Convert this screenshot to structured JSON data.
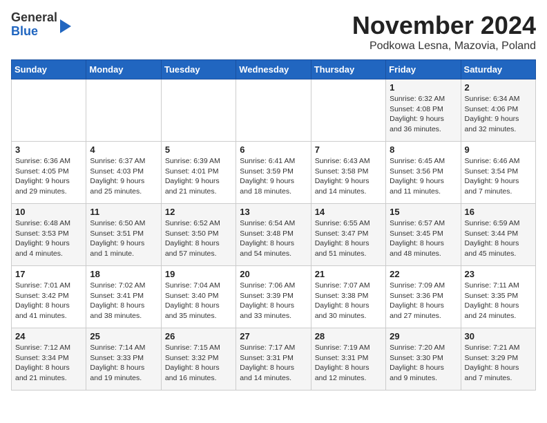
{
  "logo": {
    "general": "General",
    "blue": "Blue"
  },
  "title": "November 2024",
  "subtitle": "Podkowa Lesna, Mazovia, Poland",
  "days_of_week": [
    "Sunday",
    "Monday",
    "Tuesday",
    "Wednesday",
    "Thursday",
    "Friday",
    "Saturday"
  ],
  "weeks": [
    [
      {
        "day": "",
        "info": ""
      },
      {
        "day": "",
        "info": ""
      },
      {
        "day": "",
        "info": ""
      },
      {
        "day": "",
        "info": ""
      },
      {
        "day": "",
        "info": ""
      },
      {
        "day": "1",
        "info": "Sunrise: 6:32 AM\nSunset: 4:08 PM\nDaylight: 9 hours\nand 36 minutes."
      },
      {
        "day": "2",
        "info": "Sunrise: 6:34 AM\nSunset: 4:06 PM\nDaylight: 9 hours\nand 32 minutes."
      }
    ],
    [
      {
        "day": "3",
        "info": "Sunrise: 6:36 AM\nSunset: 4:05 PM\nDaylight: 9 hours\nand 29 minutes."
      },
      {
        "day": "4",
        "info": "Sunrise: 6:37 AM\nSunset: 4:03 PM\nDaylight: 9 hours\nand 25 minutes."
      },
      {
        "day": "5",
        "info": "Sunrise: 6:39 AM\nSunset: 4:01 PM\nDaylight: 9 hours\nand 21 minutes."
      },
      {
        "day": "6",
        "info": "Sunrise: 6:41 AM\nSunset: 3:59 PM\nDaylight: 9 hours\nand 18 minutes."
      },
      {
        "day": "7",
        "info": "Sunrise: 6:43 AM\nSunset: 3:58 PM\nDaylight: 9 hours\nand 14 minutes."
      },
      {
        "day": "8",
        "info": "Sunrise: 6:45 AM\nSunset: 3:56 PM\nDaylight: 9 hours\nand 11 minutes."
      },
      {
        "day": "9",
        "info": "Sunrise: 6:46 AM\nSunset: 3:54 PM\nDaylight: 9 hours\nand 7 minutes."
      }
    ],
    [
      {
        "day": "10",
        "info": "Sunrise: 6:48 AM\nSunset: 3:53 PM\nDaylight: 9 hours\nand 4 minutes."
      },
      {
        "day": "11",
        "info": "Sunrise: 6:50 AM\nSunset: 3:51 PM\nDaylight: 9 hours\nand 1 minute."
      },
      {
        "day": "12",
        "info": "Sunrise: 6:52 AM\nSunset: 3:50 PM\nDaylight: 8 hours\nand 57 minutes."
      },
      {
        "day": "13",
        "info": "Sunrise: 6:54 AM\nSunset: 3:48 PM\nDaylight: 8 hours\nand 54 minutes."
      },
      {
        "day": "14",
        "info": "Sunrise: 6:55 AM\nSunset: 3:47 PM\nDaylight: 8 hours\nand 51 minutes."
      },
      {
        "day": "15",
        "info": "Sunrise: 6:57 AM\nSunset: 3:45 PM\nDaylight: 8 hours\nand 48 minutes."
      },
      {
        "day": "16",
        "info": "Sunrise: 6:59 AM\nSunset: 3:44 PM\nDaylight: 8 hours\nand 45 minutes."
      }
    ],
    [
      {
        "day": "17",
        "info": "Sunrise: 7:01 AM\nSunset: 3:42 PM\nDaylight: 8 hours\nand 41 minutes."
      },
      {
        "day": "18",
        "info": "Sunrise: 7:02 AM\nSunset: 3:41 PM\nDaylight: 8 hours\nand 38 minutes."
      },
      {
        "day": "19",
        "info": "Sunrise: 7:04 AM\nSunset: 3:40 PM\nDaylight: 8 hours\nand 35 minutes."
      },
      {
        "day": "20",
        "info": "Sunrise: 7:06 AM\nSunset: 3:39 PM\nDaylight: 8 hours\nand 33 minutes."
      },
      {
        "day": "21",
        "info": "Sunrise: 7:07 AM\nSunset: 3:38 PM\nDaylight: 8 hours\nand 30 minutes."
      },
      {
        "day": "22",
        "info": "Sunrise: 7:09 AM\nSunset: 3:36 PM\nDaylight: 8 hours\nand 27 minutes."
      },
      {
        "day": "23",
        "info": "Sunrise: 7:11 AM\nSunset: 3:35 PM\nDaylight: 8 hours\nand 24 minutes."
      }
    ],
    [
      {
        "day": "24",
        "info": "Sunrise: 7:12 AM\nSunset: 3:34 PM\nDaylight: 8 hours\nand 21 minutes."
      },
      {
        "day": "25",
        "info": "Sunrise: 7:14 AM\nSunset: 3:33 PM\nDaylight: 8 hours\nand 19 minutes."
      },
      {
        "day": "26",
        "info": "Sunrise: 7:15 AM\nSunset: 3:32 PM\nDaylight: 8 hours\nand 16 minutes."
      },
      {
        "day": "27",
        "info": "Sunrise: 7:17 AM\nSunset: 3:31 PM\nDaylight: 8 hours\nand 14 minutes."
      },
      {
        "day": "28",
        "info": "Sunrise: 7:19 AM\nSunset: 3:31 PM\nDaylight: 8 hours\nand 12 minutes."
      },
      {
        "day": "29",
        "info": "Sunrise: 7:20 AM\nSunset: 3:30 PM\nDaylight: 8 hours\nand 9 minutes."
      },
      {
        "day": "30",
        "info": "Sunrise: 7:21 AM\nSunset: 3:29 PM\nDaylight: 8 hours\nand 7 minutes."
      }
    ]
  ]
}
